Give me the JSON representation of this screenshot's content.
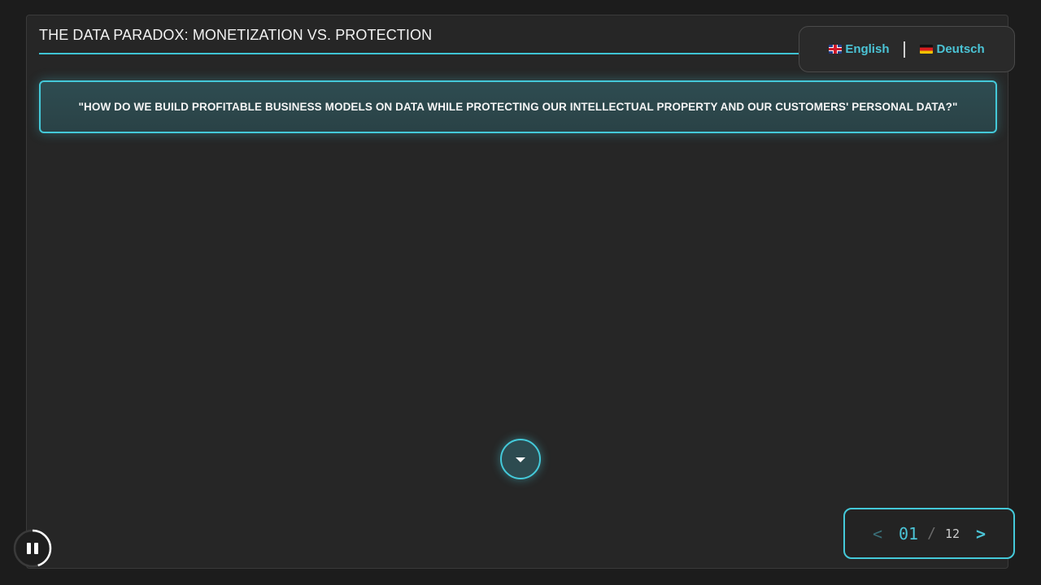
{
  "slide": {
    "title": "THE DATA PARADOX: MONETIZATION VS. PROTECTION",
    "question": "\"HOW DO WE BUILD PROFITABLE BUSINESS MODELS ON DATA WHILE PROTECTING OUR INTELLECTUAL PROPERTY AND OUR CUSTOMERS' PERSONAL DATA?\""
  },
  "language_switcher": {
    "options": [
      {
        "label": "English",
        "icon": "uk-flag-icon"
      },
      {
        "label": "Deutsch",
        "icon": "germany-flag-icon"
      }
    ]
  },
  "pager": {
    "prev_label": "<",
    "current": "01",
    "separator": "/",
    "total": "12",
    "next_label": ">"
  },
  "controls": {
    "scroll_icon": "caret-down-icon",
    "autoplay_icon": "pause-icon",
    "autoplay_progress": 0.45
  },
  "colors": {
    "accent": "#44c9d9",
    "background": "#262626"
  }
}
